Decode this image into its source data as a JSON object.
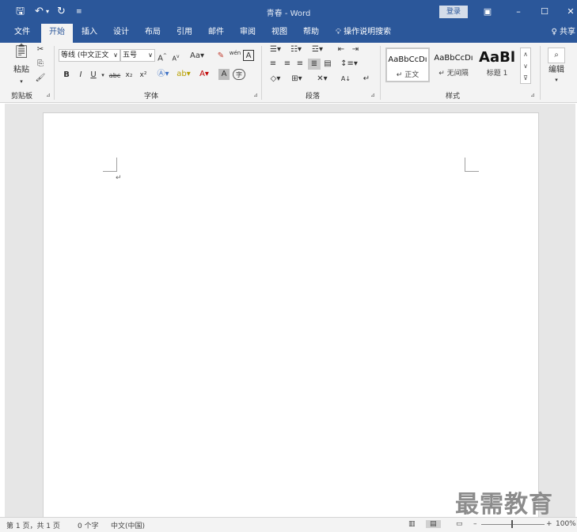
{
  "titlebar": {
    "title": "青春 - Word",
    "login_label": "登录",
    "save_icon": "save-icon",
    "undo_icon": "undo-icon",
    "redo_icon": "redo-icon",
    "customize_icon": "customize-icon"
  },
  "tabs": [
    "文件",
    "开始",
    "插入",
    "设计",
    "布局",
    "引用",
    "邮件",
    "审阅",
    "视图",
    "帮助"
  ],
  "tell_me": "操作说明搜索",
  "share": "共享",
  "ribbon": {
    "clipboard": {
      "label": "剪贴板",
      "paste": "粘贴"
    },
    "font": {
      "label": "字体",
      "font_name": "等线 (中文正文",
      "font_size": "五号",
      "bold": "B",
      "italic": "I",
      "underline": "U",
      "strike": "abc",
      "subscript": "x₂",
      "superscript": "x²",
      "case": "Aa",
      "grow": "A",
      "shrink": "A",
      "char_border": "A",
      "phonetic": "wén",
      "char_shading": "A",
      "enclose": "字"
    },
    "paragraph": {
      "label": "段落"
    },
    "styles": {
      "label": "样式",
      "items": [
        {
          "preview": "AaBbCcDı",
          "name": "正文"
        },
        {
          "preview": "AaBbCcDı",
          "name": "无间隔"
        },
        {
          "preview": "AaBl",
          "name": "标题 1"
        }
      ]
    },
    "editing": {
      "label": "编辑"
    }
  },
  "statusbar": {
    "page": "第 1 页，共 1 页",
    "words": "0 个字",
    "language": "中文(中国)",
    "zoom": "100%"
  },
  "watermark": "最需教育"
}
